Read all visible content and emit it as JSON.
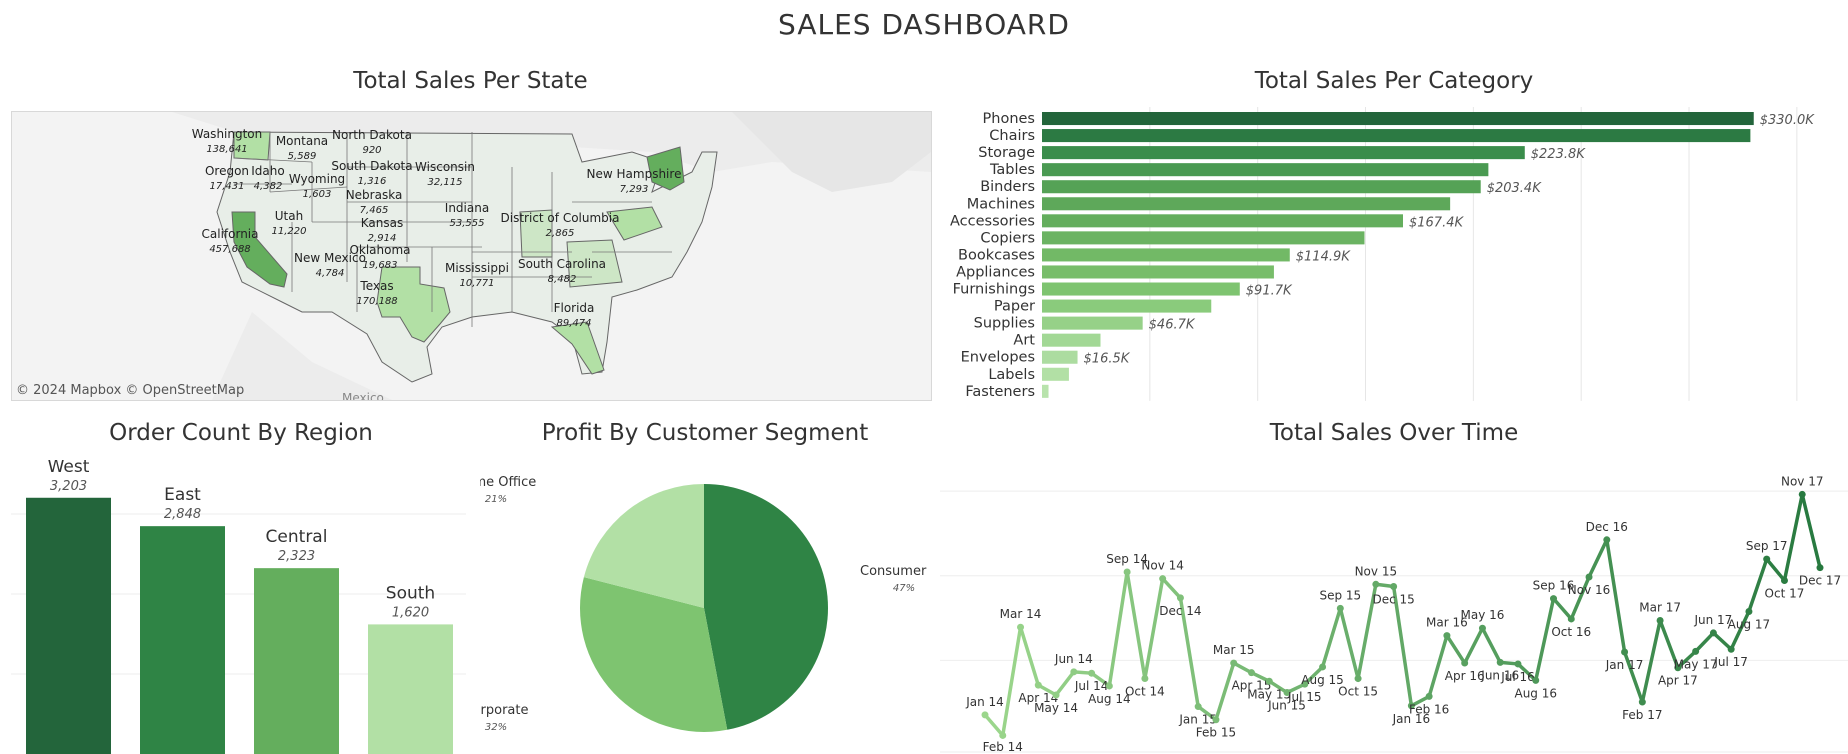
{
  "dashboard_title": "SALES DASHBOARD",
  "colors": {
    "dark": "#23653b",
    "mid_dark": "#2f8445",
    "mid": "#64ae5d",
    "mid_light": "#7ec470",
    "light": "#b2e0a5",
    "map_land": "#e8eee8",
    "map_bg": "#f3f3f3"
  },
  "map": {
    "title": "Total Sales Per State",
    "credits": "© 2024 Mapbox  © OpenStreetMap",
    "country_label": "Mexico",
    "states": [
      {
        "name": "Washington",
        "value": "138,641"
      },
      {
        "name": "Montana",
        "value": "5,589"
      },
      {
        "name": "North Dakota",
        "value": "920"
      },
      {
        "name": "Oregon",
        "value": "17,431"
      },
      {
        "name": "Idaho",
        "value": "4,382"
      },
      {
        "name": "Wyoming",
        "value": "1,603"
      },
      {
        "name": "South Dakota",
        "value": "1,316"
      },
      {
        "name": "Wisconsin",
        "value": "32,115"
      },
      {
        "name": "New Hampshire",
        "value": "7,293"
      },
      {
        "name": "Nebraska",
        "value": "7,465"
      },
      {
        "name": "Utah",
        "value": "11,220"
      },
      {
        "name": "Indiana",
        "value": "53,555"
      },
      {
        "name": "District of Columbia",
        "value": "2,865"
      },
      {
        "name": "California",
        "value": "457,688"
      },
      {
        "name": "Kansas",
        "value": "2,914"
      },
      {
        "name": "Oklahoma",
        "value": "19,683"
      },
      {
        "name": "New Mexico",
        "value": "4,784"
      },
      {
        "name": "Mississippi",
        "value": "10,771"
      },
      {
        "name": "South Carolina",
        "value": "8,482"
      },
      {
        "name": "Texas",
        "value": "170,188"
      },
      {
        "name": "Florida",
        "value": "89,474"
      }
    ]
  },
  "chart_data": [
    {
      "type": "bar",
      "orientation": "horizontal",
      "title": "Total Sales Per Category",
      "categories": [
        "Phones",
        "Chairs",
        "Storage",
        "Tables",
        "Binders",
        "Machines",
        "Accessories",
        "Copiers",
        "Bookcases",
        "Appliances",
        "Furnishings",
        "Paper",
        "Supplies",
        "Art",
        "Envelopes",
        "Labels",
        "Fasteners"
      ],
      "values": [
        330007,
        328449,
        223844,
        206966,
        203413,
        189239,
        167380,
        149528,
        114880,
        107532,
        91705,
        78479,
        46674,
        27119,
        16476,
        12486,
        3024
      ],
      "labels": [
        "$330.0K",
        "",
        "$223.8K",
        "",
        "$203.4K",
        "",
        "$167.4K",
        "",
        "$114.9K",
        "",
        "$91.7K",
        "",
        "$46.7K",
        "",
        "$16.5K",
        "",
        ""
      ],
      "xlim": [
        0,
        370000
      ],
      "grid": true
    },
    {
      "type": "bar",
      "title": "Order Count By Region",
      "categories": [
        "West",
        "East",
        "Central",
        "South"
      ],
      "values": [
        3203,
        2848,
        2323,
        1620
      ],
      "labels": [
        "3,203",
        "2,848",
        "2,323",
        "1,620"
      ],
      "ylim": [
        0,
        3300
      ],
      "grid": true
    },
    {
      "type": "pie",
      "title": "Profit By Customer Segment",
      "slices": [
        {
          "name": "Consumer",
          "value": 47,
          "label": "47%"
        },
        {
          "name": "Corporate",
          "value": 32,
          "label": "32%"
        },
        {
          "name": "Home Office",
          "value": 21,
          "label": "21%"
        }
      ]
    },
    {
      "type": "line",
      "title": "Total Sales Over Time",
      "x": [
        "Jan 14",
        "Feb 14",
        "Mar 14",
        "Apr 14",
        "May 14",
        "Jun 14",
        "Jul 14",
        "Aug 14",
        "Sep 14",
        "Oct 14",
        "Nov 14",
        "Dec 14",
        "Jan 15",
        "Feb 15",
        "Mar 15",
        "Apr 15",
        "May 15",
        "Jun 15",
        "Jul 15",
        "Aug 15",
        "Sep 15",
        "Oct 15",
        "Nov 15",
        "Dec 15",
        "Jan 16",
        "Feb 16",
        "Mar 16",
        "Apr 16",
        "May 16",
        "Jun 16",
        "Jul 16",
        "Aug 16",
        "Sep 16",
        "Oct 16",
        "Nov 16",
        "Dec 16",
        "Jan 17",
        "Feb 17",
        "Mar 17",
        "Apr 17",
        "May 17",
        "Jun 17",
        "Jul 17",
        "Aug 17",
        "Sep 17",
        "Oct 17",
        "Nov 17",
        "Dec 17"
      ],
      "y": [
        14237,
        4520,
        55691,
        28295,
        23648,
        34595,
        33946,
        27909,
        81777,
        31453,
        78629,
        69546,
        18174,
        11951,
        38726,
        34195,
        30132,
        24797,
        28765,
        36898,
        64596,
        31405,
        75973,
        74920,
        18542,
        22979,
        51716,
        38751,
        55209,
        39069,
        38320,
        30542,
        69193,
        59583,
        79412,
        96999,
        43971,
        20301,
        58872,
        36522,
        44261,
        52982,
        45264,
        63121,
        87867,
        77777,
        118448,
        83829
      ],
      "ylim": [
        0,
        130000
      ],
      "grid": true
    }
  ]
}
